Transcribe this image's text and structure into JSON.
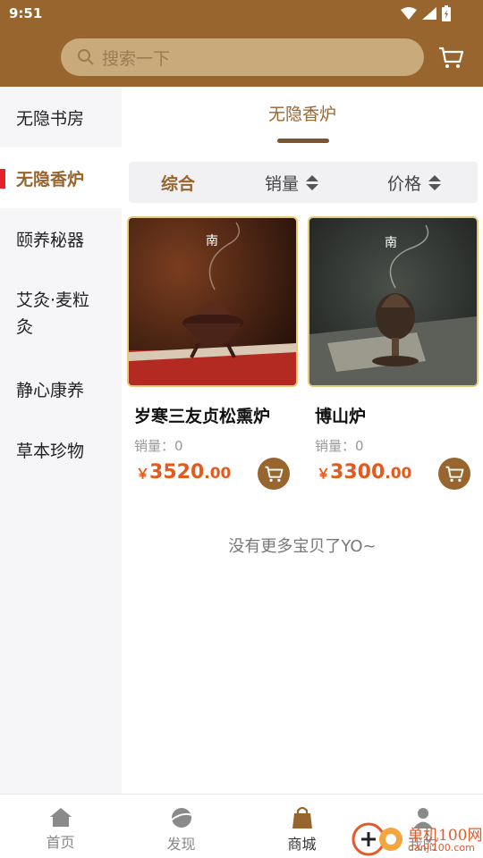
{
  "status_bar": {
    "time": "9:51"
  },
  "search": {
    "placeholder": "搜索一下"
  },
  "sidebar": {
    "items": [
      {
        "label": "无隐书房",
        "active": false
      },
      {
        "label": "无隐香炉",
        "active": true
      },
      {
        "label": "颐养秘器",
        "active": false
      },
      {
        "label": "艾灸·麦粒灸",
        "active": false
      },
      {
        "label": "静心康养",
        "active": false
      },
      {
        "label": "草本珍物",
        "active": false
      }
    ]
  },
  "category": {
    "title": "无隐香炉"
  },
  "sort": {
    "comprehensive": "综合",
    "sales": "销量",
    "price": "价格"
  },
  "products": [
    {
      "name": "岁寒三友贞松熏炉",
      "sales": "销量：0",
      "currency": "￥",
      "price_int": "3520",
      "price_dec": ".00"
    },
    {
      "name": "博山炉",
      "sales": "销量：0",
      "currency": "￥",
      "price_int": "3300",
      "price_dec": ".00"
    }
  ],
  "no_more": "没有更多宝贝了YO~",
  "tabbar": {
    "home": "首页",
    "discover": "发现",
    "mall": "商城",
    "mine": "我的"
  },
  "watermark": {
    "text": "单机100网",
    "url": "danji100.com"
  },
  "colors": {
    "brand": "#98652f",
    "price": "#e45a1c",
    "active_marker": "#e8202a"
  },
  "icons": [
    "search-icon",
    "cart-icon",
    "home-icon",
    "discover-icon",
    "mall-bag-icon",
    "user-icon"
  ]
}
